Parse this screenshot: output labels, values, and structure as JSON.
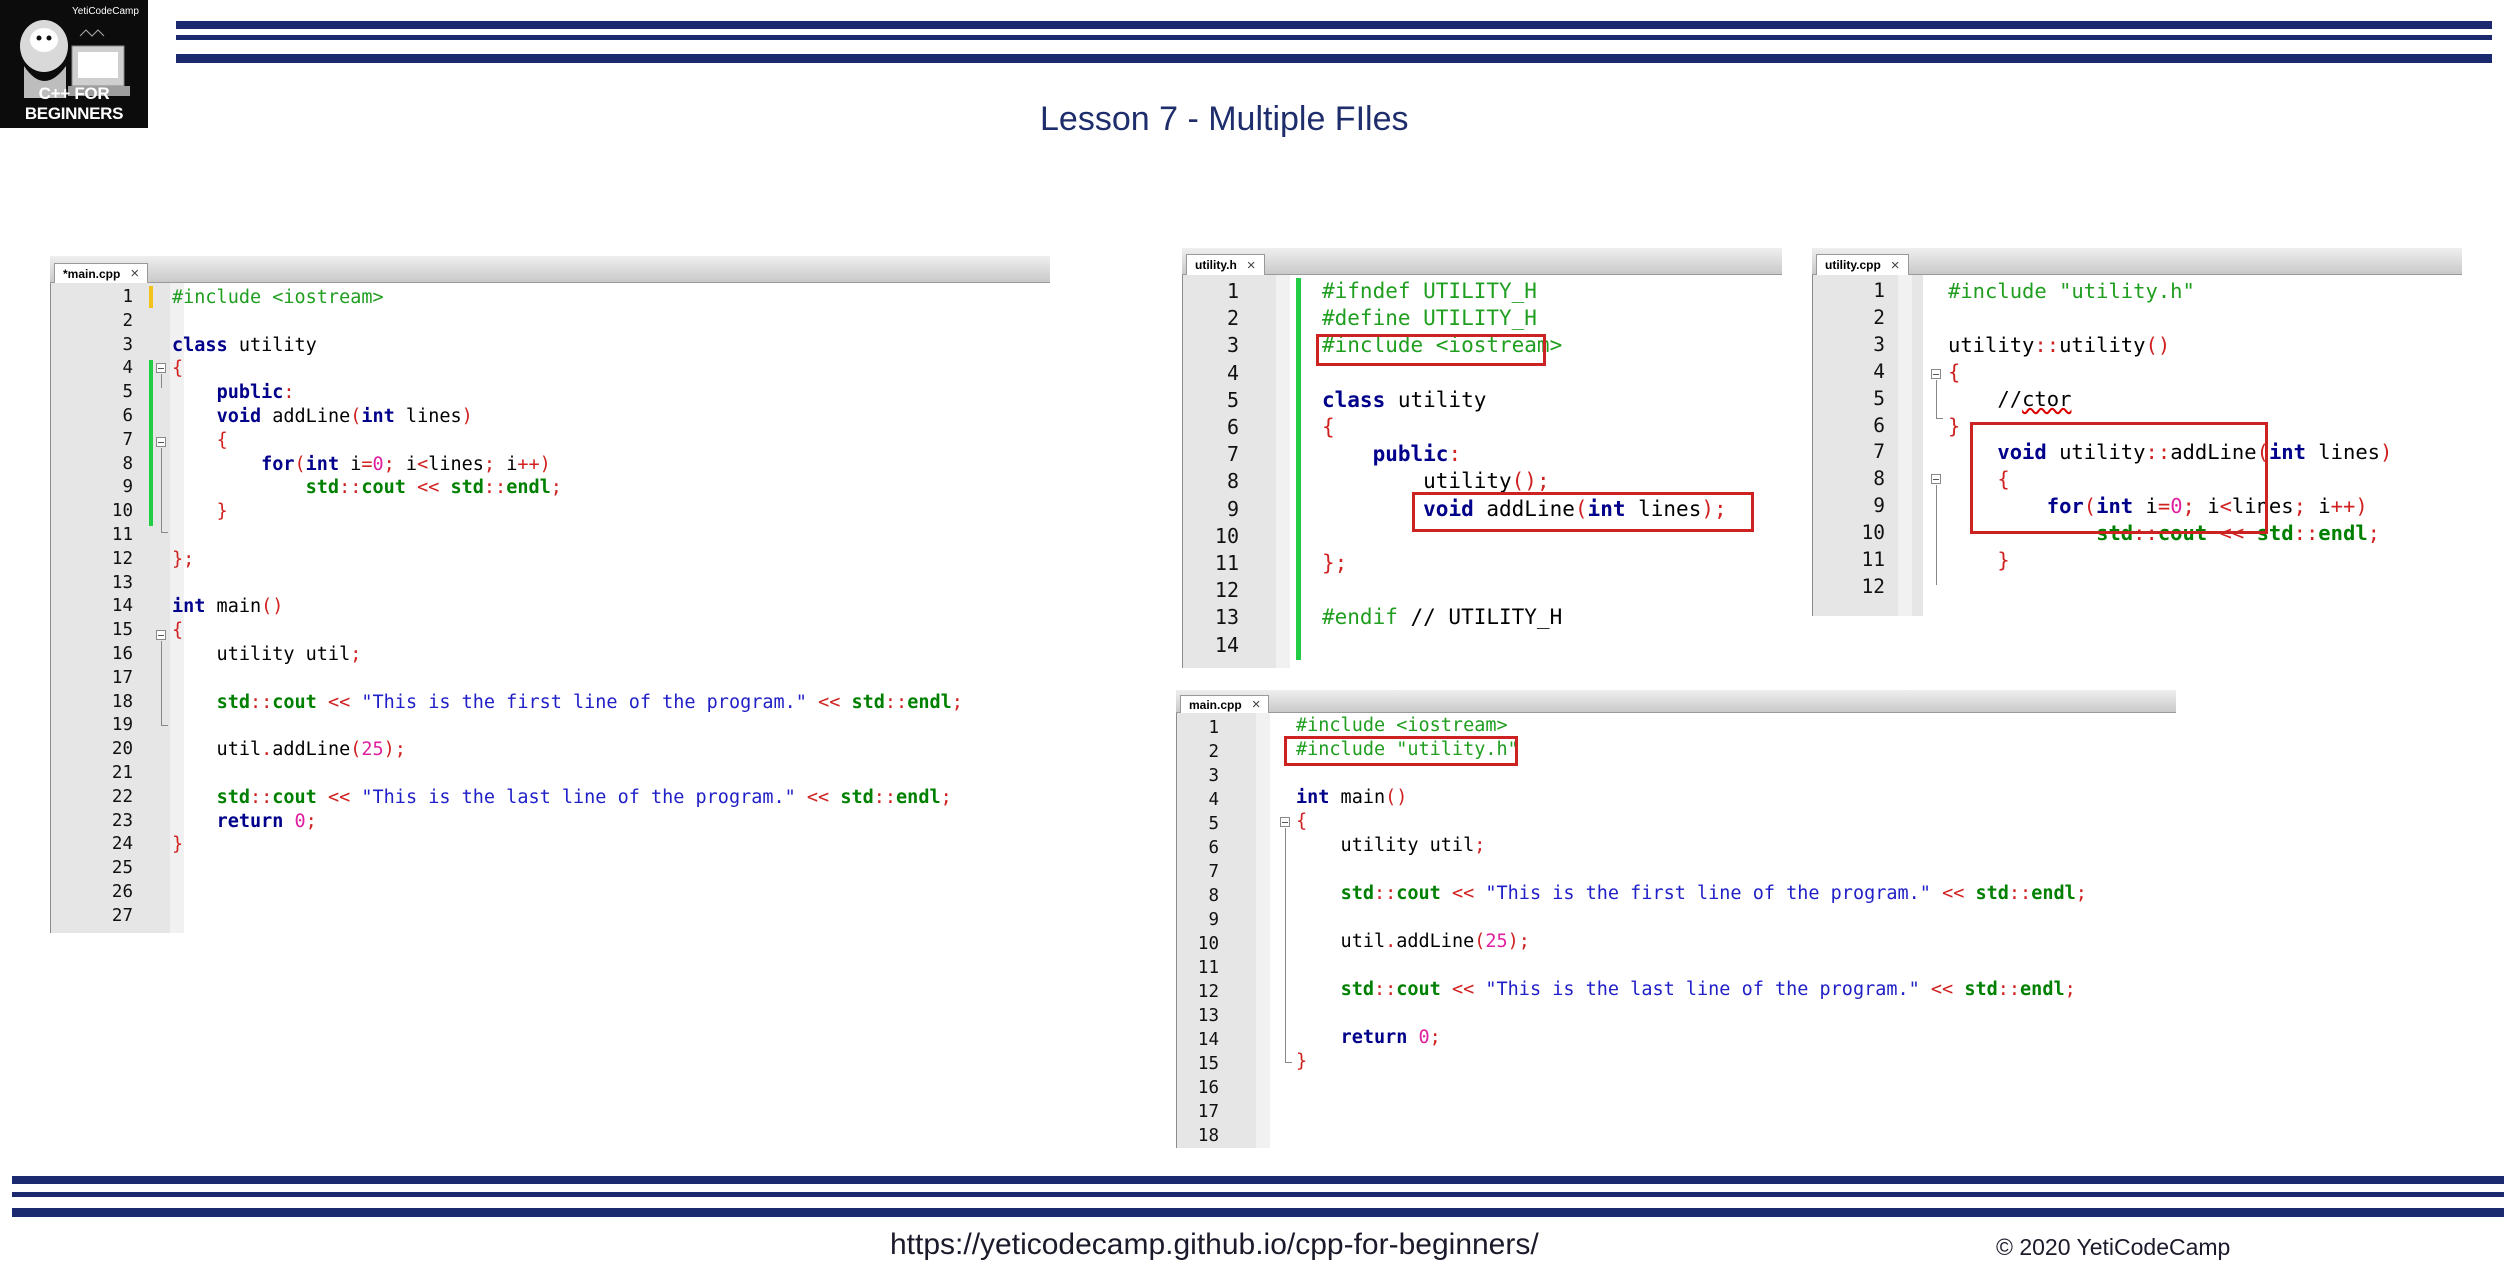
{
  "header": {
    "logo_text": "C++ FOR BEGINNERS",
    "logo_badge": "YetiCodeCamp",
    "title": "Lesson 7 - Multiple FIles"
  },
  "footer": {
    "url": "https://yeticodecamp.github.io/cpp-for-beginners/",
    "copyright": "© 2020 YetiCodeCamp"
  },
  "colors": {
    "accent_navy": "#1b2a6e",
    "keyword": "#00008b",
    "preprocessor": "#1f9e1f",
    "string": "#2020c8",
    "number": "#e020a0",
    "operator": "#d02020",
    "highlight_box": "#cc2222",
    "change_bar": "#22cc44"
  },
  "editors": {
    "main_original": {
      "tab": "*main.cpp",
      "line_numbers": [
        "1",
        "2",
        "3",
        "4",
        "5",
        "6",
        "7",
        "8",
        "9",
        "10",
        "11",
        "12",
        "13",
        "14",
        "15",
        "16",
        "17",
        "18",
        "19",
        "20",
        "21",
        "22",
        "23",
        "24",
        "25",
        "26",
        "27"
      ],
      "lines": [
        [
          [
            "p",
            "#include <iostream>"
          ]
        ],
        [],
        [
          [
            "k",
            "class"
          ],
          [
            "t",
            " utility"
          ]
        ],
        [
          [
            "o",
            "{"
          ]
        ],
        [
          [
            "t",
            "    "
          ],
          [
            "k",
            "public"
          ],
          [
            "o",
            ":"
          ]
        ],
        [
          [
            "t",
            "    "
          ],
          [
            "k",
            "void"
          ],
          [
            "t",
            " addLine"
          ],
          [
            "o",
            "("
          ],
          [
            "k",
            "int"
          ],
          [
            "t",
            " lines"
          ],
          [
            "o",
            ")"
          ]
        ],
        [
          [
            "t",
            "    "
          ],
          [
            "o",
            "{"
          ]
        ],
        [
          [
            "t",
            "        "
          ],
          [
            "k",
            "for"
          ],
          [
            "o",
            "("
          ],
          [
            "k",
            "int"
          ],
          [
            "t",
            " i"
          ],
          [
            "o",
            "="
          ],
          [
            "n",
            "0"
          ],
          [
            "o",
            ";"
          ],
          [
            "t",
            " i"
          ],
          [
            "o",
            "<"
          ],
          [
            "t",
            "lines"
          ],
          [
            "o",
            ";"
          ],
          [
            "t",
            " i"
          ],
          [
            "o",
            "++)"
          ]
        ],
        [
          [
            "t",
            "            "
          ],
          [
            "g",
            "std"
          ],
          [
            "o",
            "::"
          ],
          [
            "g",
            "cout"
          ],
          [
            "t",
            " "
          ],
          [
            "o",
            "<<"
          ],
          [
            "t",
            " "
          ],
          [
            "g",
            "std"
          ],
          [
            "o",
            "::"
          ],
          [
            "g",
            "endl"
          ],
          [
            "o",
            ";"
          ]
        ],
        [
          [
            "t",
            "    "
          ],
          [
            "o",
            "}"
          ]
        ],
        [],
        [
          [
            "o",
            "};"
          ]
        ],
        [],
        [
          [
            "k",
            "int"
          ],
          [
            "t",
            " main"
          ],
          [
            "o",
            "()"
          ]
        ],
        [
          [
            "o",
            "{"
          ]
        ],
        [
          [
            "t",
            "    utility util"
          ],
          [
            "o",
            ";"
          ]
        ],
        [],
        [
          [
            "t",
            "    "
          ],
          [
            "g",
            "std"
          ],
          [
            "o",
            "::"
          ],
          [
            "g",
            "cout"
          ],
          [
            "t",
            " "
          ],
          [
            "o",
            "<<"
          ],
          [
            "t",
            " "
          ],
          [
            "s",
            "\"This is the first line of the program.\""
          ],
          [
            "t",
            " "
          ],
          [
            "o",
            "<<"
          ],
          [
            "t",
            " "
          ],
          [
            "g",
            "std"
          ],
          [
            "o",
            "::"
          ],
          [
            "g",
            "endl"
          ],
          [
            "o",
            ";"
          ]
        ],
        [],
        [
          [
            "t",
            "    util"
          ],
          [
            "o",
            "."
          ],
          [
            "t",
            "addLine"
          ],
          [
            "o",
            "("
          ],
          [
            "n",
            "25"
          ],
          [
            "o",
            ");"
          ]
        ],
        [],
        [
          [
            "t",
            "    "
          ],
          [
            "g",
            "std"
          ],
          [
            "o",
            "::"
          ],
          [
            "g",
            "cout"
          ],
          [
            "t",
            " "
          ],
          [
            "o",
            "<<"
          ],
          [
            "t",
            " "
          ],
          [
            "s",
            "\"This is the last line of the program.\""
          ],
          [
            "t",
            " "
          ],
          [
            "o",
            "<<"
          ],
          [
            "t",
            " "
          ],
          [
            "g",
            "std"
          ],
          [
            "o",
            "::"
          ],
          [
            "g",
            "endl"
          ],
          [
            "o",
            ";"
          ]
        ],
        [
          [
            "t",
            "    "
          ],
          [
            "k",
            "return"
          ],
          [
            "t",
            " "
          ],
          [
            "n",
            "0"
          ],
          [
            "o",
            ";"
          ]
        ],
        [
          [
            "o",
            "}"
          ]
        ],
        [],
        [],
        []
      ]
    },
    "utility_h": {
      "tab": "utility.h",
      "line_numbers": [
        "1",
        "2",
        "3",
        "4",
        "5",
        "6",
        "7",
        "8",
        "9",
        "10",
        "11",
        "12",
        "13",
        "14"
      ],
      "lines": [
        [
          [
            "p",
            "#ifndef UTILITY_H"
          ]
        ],
        [
          [
            "p",
            "#define UTILITY_H"
          ]
        ],
        [
          [
            "p",
            "#include <iostream>"
          ]
        ],
        [],
        [
          [
            "k",
            "class"
          ],
          [
            "t",
            " utility"
          ]
        ],
        [
          [
            "o",
            "{"
          ]
        ],
        [
          [
            "t",
            "    "
          ],
          [
            "k",
            "public"
          ],
          [
            "o",
            ":"
          ]
        ],
        [
          [
            "t",
            "        utility"
          ],
          [
            "o",
            "();"
          ]
        ],
        [
          [
            "t",
            "        "
          ],
          [
            "k",
            "void"
          ],
          [
            "t",
            " addLine"
          ],
          [
            "o",
            "("
          ],
          [
            "k",
            "int"
          ],
          [
            "t",
            " lines"
          ],
          [
            "o",
            ");"
          ]
        ],
        [],
        [
          [
            "o",
            "};"
          ]
        ],
        [],
        [
          [
            "p",
            "#endif"
          ],
          [
            "t",
            " // UTILITY_H"
          ]
        ],
        []
      ]
    },
    "utility_cpp": {
      "tab": "utility.cpp",
      "line_numbers": [
        "1",
        "2",
        "3",
        "4",
        "5",
        "6",
        "7",
        "8",
        "9",
        "10",
        "11",
        "12"
      ],
      "lines": [
        [
          [
            "p",
            "#include \"utility.h\""
          ]
        ],
        [],
        [
          [
            "t",
            "utility"
          ],
          [
            "o",
            "::"
          ],
          [
            "t",
            "utility"
          ],
          [
            "o",
            "()"
          ]
        ],
        [
          [
            "o",
            "{"
          ]
        ],
        [
          [
            "t",
            "    //"
          ],
          [
            "q",
            "ctor"
          ]
        ],
        [
          [
            "o",
            "}"
          ]
        ],
        [
          [
            "t",
            "    "
          ],
          [
            "k",
            "void"
          ],
          [
            "t",
            " utility"
          ],
          [
            "o",
            "::"
          ],
          [
            "t",
            "addLine"
          ],
          [
            "o",
            "("
          ],
          [
            "k",
            "int"
          ],
          [
            "t",
            " lines"
          ],
          [
            "o",
            ")"
          ]
        ],
        [
          [
            "t",
            "    "
          ],
          [
            "o",
            "{"
          ]
        ],
        [
          [
            "t",
            "        "
          ],
          [
            "k",
            "for"
          ],
          [
            "o",
            "("
          ],
          [
            "k",
            "int"
          ],
          [
            "t",
            " i"
          ],
          [
            "o",
            "="
          ],
          [
            "n",
            "0"
          ],
          [
            "o",
            ";"
          ],
          [
            "t",
            " i"
          ],
          [
            "o",
            "<"
          ],
          [
            "t",
            "lines"
          ],
          [
            "o",
            ";"
          ],
          [
            "t",
            " i"
          ],
          [
            "o",
            "++)"
          ]
        ],
        [
          [
            "t",
            "            "
          ],
          [
            "g",
            "std"
          ],
          [
            "o",
            "::"
          ],
          [
            "g",
            "cout"
          ],
          [
            "t",
            " "
          ],
          [
            "o",
            "<<"
          ],
          [
            "t",
            " "
          ],
          [
            "g",
            "std"
          ],
          [
            "o",
            "::"
          ],
          [
            "g",
            "endl"
          ],
          [
            "o",
            ";"
          ]
        ],
        [
          [
            "t",
            "    "
          ],
          [
            "o",
            "}"
          ]
        ],
        []
      ]
    },
    "main_new": {
      "tab": "main.cpp",
      "line_numbers": [
        "1",
        "2",
        "3",
        "4",
        "5",
        "6",
        "7",
        "8",
        "9",
        "10",
        "11",
        "12",
        "13",
        "14",
        "15",
        "16",
        "17",
        "18"
      ],
      "lines": [
        [
          [
            "p",
            "#include <iostream>"
          ]
        ],
        [
          [
            "p",
            "#include \"utility.h\""
          ]
        ],
        [],
        [
          [
            "k",
            "int"
          ],
          [
            "t",
            " main"
          ],
          [
            "o",
            "()"
          ]
        ],
        [
          [
            "o",
            "{"
          ]
        ],
        [
          [
            "t",
            "    utility util"
          ],
          [
            "o",
            ";"
          ]
        ],
        [],
        [
          [
            "t",
            "    "
          ],
          [
            "g",
            "std"
          ],
          [
            "o",
            "::"
          ],
          [
            "g",
            "cout"
          ],
          [
            "t",
            " "
          ],
          [
            "o",
            "<<"
          ],
          [
            "t",
            " "
          ],
          [
            "s",
            "\"This is the first line of the program.\""
          ],
          [
            "t",
            " "
          ],
          [
            "o",
            "<<"
          ],
          [
            "t",
            " "
          ],
          [
            "g",
            "std"
          ],
          [
            "o",
            "::"
          ],
          [
            "g",
            "endl"
          ],
          [
            "o",
            ";"
          ]
        ],
        [],
        [
          [
            "t",
            "    util"
          ],
          [
            "o",
            "."
          ],
          [
            "t",
            "addLine"
          ],
          [
            "o",
            "("
          ],
          [
            "n",
            "25"
          ],
          [
            "o",
            ");"
          ]
        ],
        [],
        [
          [
            "t",
            "    "
          ],
          [
            "g",
            "std"
          ],
          [
            "o",
            "::"
          ],
          [
            "g",
            "cout"
          ],
          [
            "t",
            " "
          ],
          [
            "o",
            "<<"
          ],
          [
            "t",
            " "
          ],
          [
            "s",
            "\"This is the last line of the program.\""
          ],
          [
            "t",
            " "
          ],
          [
            "o",
            "<<"
          ],
          [
            "t",
            " "
          ],
          [
            "g",
            "std"
          ],
          [
            "o",
            "::"
          ],
          [
            "g",
            "endl"
          ],
          [
            "o",
            ";"
          ]
        ],
        [],
        [
          [
            "t",
            "    "
          ],
          [
            "k",
            "return"
          ],
          [
            "t",
            " "
          ],
          [
            "n",
            "0"
          ],
          [
            "o",
            ";"
          ]
        ],
        [
          [
            "o",
            "}"
          ]
        ],
        [],
        [],
        []
      ]
    }
  }
}
